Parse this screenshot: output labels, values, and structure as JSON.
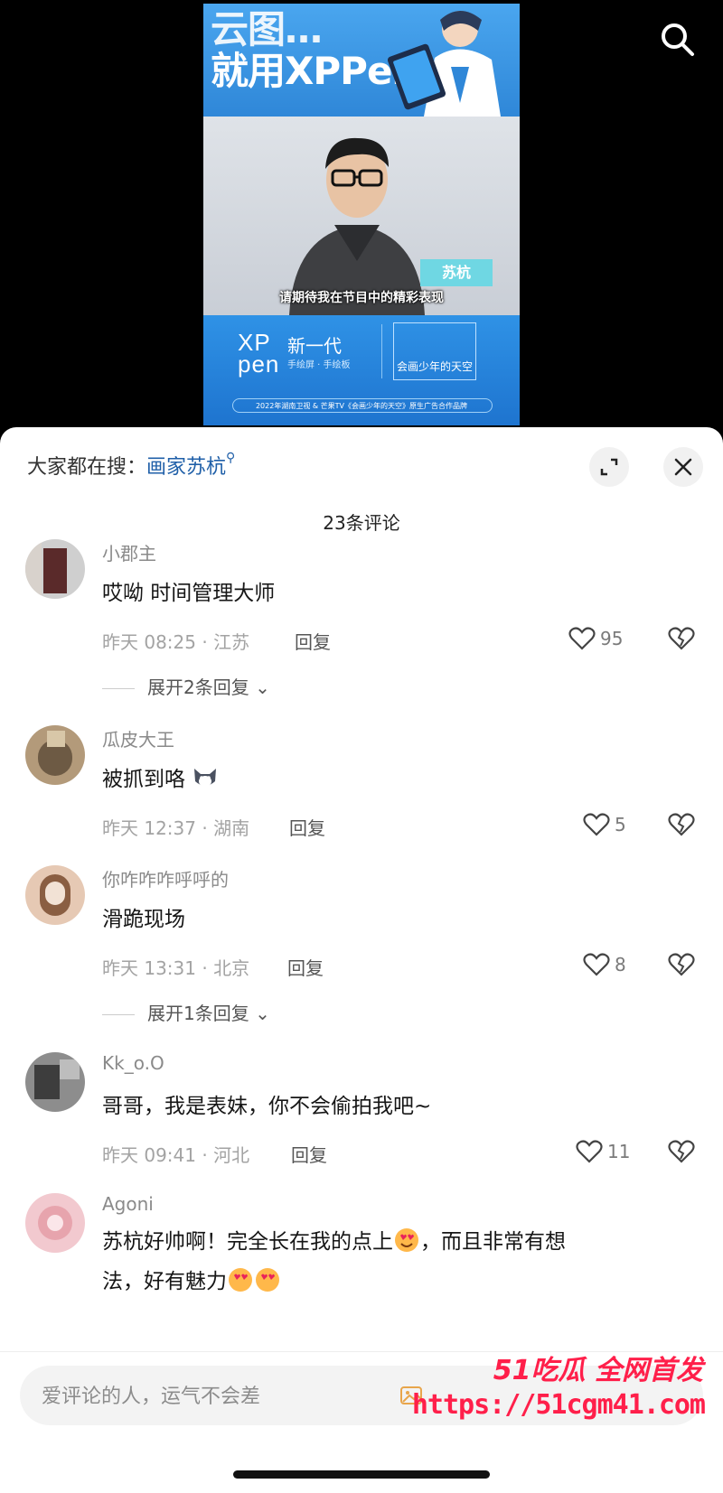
{
  "video": {
    "banner_line1": "云图…",
    "banner_line2": "就用XPPen",
    "name_tag": "苏杭",
    "subtitle": "请期待我在节目中的精彩表现",
    "brand_logo_line1": "XP",
    "brand_logo_line2": "pen",
    "brand_gen": "新一代",
    "brand_sub": "手绘屏 · 手绘板",
    "brand_box_text": "会画少年的天空",
    "brand_foot": "2022年湖南卫视 & 芒果TV《会画少年的天空》原生广告合作品牌"
  },
  "sheet": {
    "hot_search_prefix": "大家都在搜：",
    "hot_search_keyword": "画家苏杭",
    "comment_count_title": "23条评论"
  },
  "comments": [
    {
      "username": "小郡主",
      "text": "哎呦 时间管理大师",
      "meta": "昨天 08:25 · 江苏",
      "reply": "回复",
      "likes": "95",
      "expand": "展开2条回复",
      "avatar_colors": [
        "#cfcfcf",
        "#5a2a2a",
        "#d8d2cc"
      ]
    },
    {
      "username": "瓜皮大王",
      "text": "被抓到咯",
      "meta": "昨天 12:37 · 湖南",
      "reply": "回复",
      "likes": "5",
      "expand": "",
      "avatar_colors": [
        "#b39a7a",
        "#6d5a44",
        "#d8c7a8"
      ]
    },
    {
      "username": "你咋咋咋呼呼的",
      "text": "滑跪现场",
      "meta": "昨天 13:31 · 北京",
      "reply": "回复",
      "likes": "8",
      "expand": "展开1条回复",
      "avatar_colors": [
        "#e6c9b4",
        "#8a5e42",
        "#f2e2d5"
      ]
    },
    {
      "username": "Kk_o.O",
      "text": "哥哥，我是表妹，你不会偷拍我吧~",
      "meta": "昨天 09:41 · 河北",
      "reply": "回复",
      "likes": "11",
      "expand": "",
      "avatar_colors": [
        "#8d8d8d",
        "#3d3d3d",
        "#bdbdbd"
      ]
    },
    {
      "username": "Agoni",
      "text": "苏杭好帅啊！完全长在我的点上",
      "text2": "，而且非常有想",
      "text3": "法，好有魅力",
      "meta": "",
      "reply": "",
      "likes": "",
      "expand": "",
      "avatar_colors": [
        "#f2c9cf",
        "#e7a4ad",
        "#fbe6e9"
      ]
    }
  ],
  "input": {
    "placeholder": "爱评论的人，运气不会差"
  },
  "watermark": {
    "top": "51吃瓜 全网首发",
    "url": "https://51cgm41.com"
  },
  "icons": {
    "search": "search-icon",
    "expand": "expand-icon",
    "close": "close-icon",
    "like": "heart-icon",
    "dislike": "broken-heart-icon",
    "chevron": "chevron-down-icon"
  }
}
